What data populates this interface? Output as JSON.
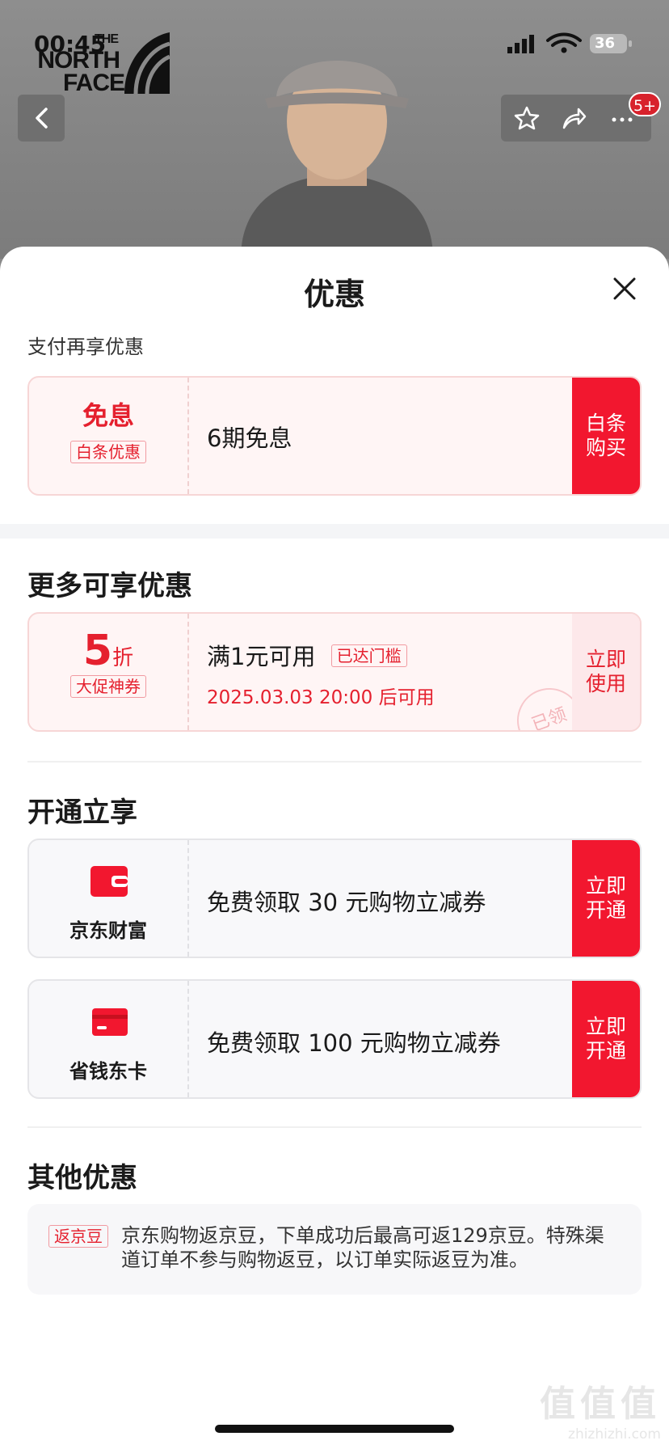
{
  "status": {
    "time": "00:45",
    "battery": "36"
  },
  "brand": {
    "line1": "THE",
    "line2": "NORTH",
    "line3": "FACE"
  },
  "header": {
    "badge": "5+"
  },
  "sheet": {
    "title": "优惠"
  },
  "pay_section": {
    "title": "支付再享优惠",
    "card": {
      "big": "免息",
      "tag": "白条优惠",
      "text": "6期免息",
      "action": "白条\n购买"
    }
  },
  "more_section": {
    "title": "更多可享优惠",
    "card": {
      "big": "5",
      "unit": "折",
      "tag": "大促神券",
      "text": "满1元可用",
      "status_tag": "已达门槛",
      "time": "2025.03.03 20:00 后可用",
      "stamp": "已领",
      "action": "立即\n使用"
    }
  },
  "open_section": {
    "title": "开通立享",
    "cards": [
      {
        "label": "京东财富",
        "text": "免费领取 30 元购物立减券",
        "action": "立即\n开通"
      },
      {
        "label": "省钱东卡",
        "text": "免费领取 100 元购物立减券",
        "action": "立即\n开通"
      }
    ]
  },
  "other_section": {
    "title": "其他优惠",
    "tag": "返京豆",
    "text": "京东购物返京豆，下单成功后最高可返129京豆。特殊渠道订单不参与购物返豆，以订单实际返豆为准。"
  },
  "watermark": {
    "main": "值值值",
    "sub": "zhizhizhi.com"
  },
  "colors": {
    "accent": "#f2172f",
    "accent_text": "#e5202e",
    "soft_bg": "#fff5f5"
  }
}
